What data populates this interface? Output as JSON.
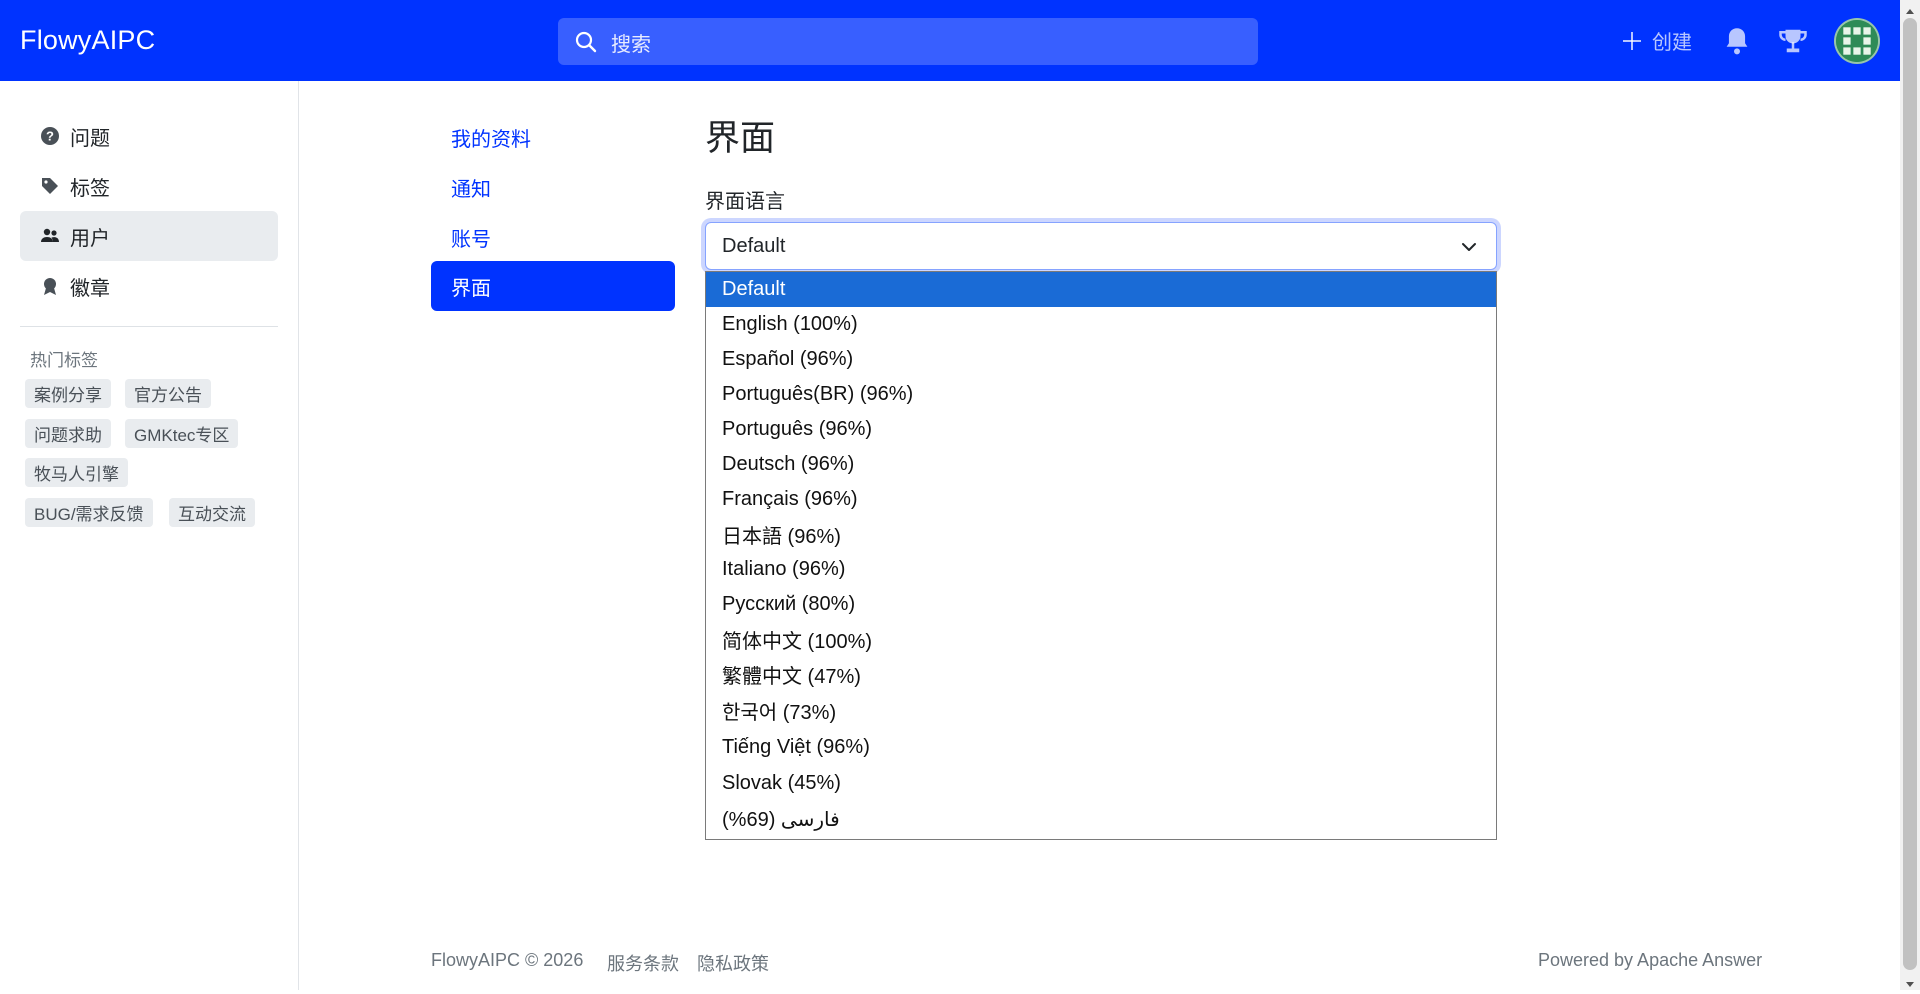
{
  "header": {
    "brand": "FlowyAIPC",
    "search_placeholder": "搜索",
    "create_label": "创建",
    "colors": {
      "header_bg": "#0033ff",
      "accent": "#0033ff"
    }
  },
  "sidebar": {
    "items": [
      {
        "label": "问题",
        "icon": "question-circle-icon"
      },
      {
        "label": "标签",
        "icon": "tags-icon"
      },
      {
        "label": "用户",
        "icon": "people-icon",
        "active": true
      },
      {
        "label": "徽章",
        "icon": "award-icon"
      }
    ],
    "hot_tags_title": "热门标签",
    "hot_tags": [
      "案例分享",
      "官方公告",
      "问题求助",
      "GMKtec专区",
      "牧马人引擎",
      "BUG/需求反馈",
      "互动交流"
    ]
  },
  "settings_nav": {
    "items": [
      {
        "label": "我的资料"
      },
      {
        "label": "通知"
      },
      {
        "label": "账号"
      },
      {
        "label": "界面",
        "active": true
      }
    ]
  },
  "main": {
    "title": "界面",
    "language_label": "界面语言",
    "selected_language": "Default",
    "options": [
      "Default",
      "English (100%)",
      "Español (96%)",
      "Português(BR) (96%)",
      "Português (96%)",
      "Deutsch (96%)",
      "Français (96%)",
      "日本語 (96%)",
      "Italiano (96%)",
      "Русский (80%)",
      "简体中文 (100%)",
      "繁體中文 (47%)",
      "한국어 (73%)",
      "Tiếng Việt (96%)",
      "Slovak (45%)",
      "فارسی (69%)"
    ]
  },
  "footer": {
    "copyright": "FlowyAIPC © 2026",
    "terms": "服务条款",
    "privacy": "隐私政策",
    "powered": "Powered by Apache Answer"
  }
}
